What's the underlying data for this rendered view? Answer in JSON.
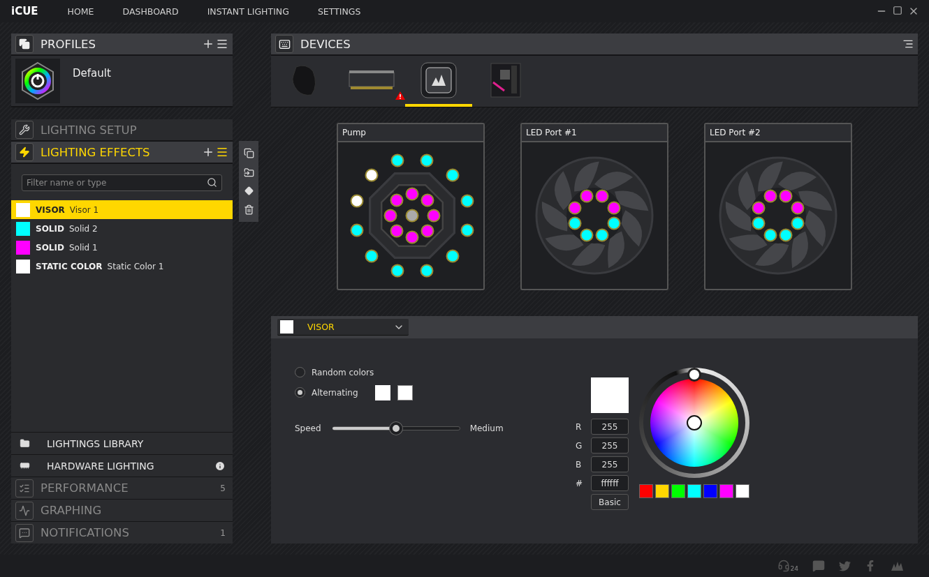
{
  "app": {
    "logo": "iCUE",
    "nav": [
      {
        "label": "HOME"
      },
      {
        "label": "DASHBOARD"
      },
      {
        "label": "INSTANT LIGHTING"
      },
      {
        "label": "SETTINGS"
      }
    ]
  },
  "profiles": {
    "title": "PROFILES",
    "items": [
      {
        "name": "Default"
      }
    ]
  },
  "sections": [
    {
      "label": "LIGHTING SETUP",
      "selected": false
    },
    {
      "label": "LIGHTING EFFECTS",
      "selected": true
    }
  ],
  "filter": {
    "placeholder": "Filter name or type"
  },
  "effects": [
    {
      "type": "VISOR",
      "name": "Visor 1",
      "color": "#ffffff",
      "selected": true
    },
    {
      "type": "SOLID",
      "name": "Solid 2",
      "color": "#00ffff",
      "selected": false
    },
    {
      "type": "SOLID",
      "name": "Solid 1",
      "color": "#ff00ff",
      "selected": false
    },
    {
      "type": "STATIC COLOR",
      "name": "Static Color 1",
      "color": "#ffffff",
      "selected": false
    }
  ],
  "bottom_items": [
    {
      "kind": "library",
      "label": "LIGHTINGS LIBRARY"
    },
    {
      "kind": "hardware",
      "label": "HARDWARE LIGHTING",
      "info": true
    },
    {
      "kind": "performance",
      "label": "PERFORMANCE",
      "badge": "5"
    },
    {
      "kind": "graphing",
      "label": "GRAPHING"
    },
    {
      "kind": "notifications",
      "label": "NOTIFICATIONS",
      "badge": "1"
    }
  ],
  "devices": {
    "title": "DEVICES",
    "items": [
      {
        "kind": "mouse",
        "selected": false,
        "warning": false
      },
      {
        "kind": "memory",
        "selected": false,
        "warning": true
      },
      {
        "kind": "cooler",
        "selected": true,
        "warning": false
      },
      {
        "kind": "motherboard",
        "selected": false,
        "warning": false
      }
    ]
  },
  "zones": [
    {
      "label": "Pump",
      "kind": "pump",
      "outer": [
        {
          "color": "#00ffff"
        },
        {
          "color": "#00ffff"
        },
        {
          "color": "#00ffff"
        },
        {
          "color": "#00ffff"
        },
        {
          "color": "#00ffff"
        },
        {
          "color": "#00ffff"
        },
        {
          "color": "#00ffff"
        },
        {
          "color": "#00ffff"
        },
        {
          "color": "#00ffff"
        },
        {
          "color": "#ffffff"
        },
        {
          "color": "#ffffff"
        },
        {
          "color": "#00ffff"
        }
      ],
      "inner": [
        {
          "color": "#ff00ff"
        },
        {
          "color": "#ff00ff"
        },
        {
          "color": "#ff00ff"
        },
        {
          "color": "#ff00ff"
        },
        {
          "color": "#ff00ff"
        },
        {
          "color": "#ff00ff"
        },
        {
          "color": "#ff00ff"
        },
        {
          "color": "#ff00ff"
        }
      ],
      "center": {
        "color": "#aaaaaa"
      }
    },
    {
      "label": "LED Port #1",
      "kind": "fan",
      "inner": [
        {
          "color": "#ff00ff"
        },
        {
          "color": "#ff00ff"
        },
        {
          "color": "#00ffff"
        },
        {
          "color": "#00ffff"
        },
        {
          "color": "#00ffff"
        },
        {
          "color": "#00ffff"
        },
        {
          "color": "#ff00ff"
        },
        {
          "color": "#ff00ff"
        }
      ]
    },
    {
      "label": "LED Port #2",
      "kind": "fan",
      "inner": [
        {
          "color": "#ff00ff"
        },
        {
          "color": "#ff00ff"
        },
        {
          "color": "#00ffff"
        },
        {
          "color": "#00ffff"
        },
        {
          "color": "#00ffff"
        },
        {
          "color": "#00ffff"
        },
        {
          "color": "#ff00ff"
        },
        {
          "color": "#ff00ff"
        }
      ]
    }
  ],
  "effect_editor": {
    "effect": {
      "label": "VISOR",
      "color": "#ffffff"
    },
    "options": [
      {
        "label": "Random colors",
        "selected": false
      },
      {
        "label": "Alternating",
        "selected": true,
        "colors": [
          {
            "color": "#ffffff"
          },
          {
            "color": "#ffffff"
          }
        ]
      }
    ],
    "speed": {
      "label": "Speed",
      "level": 0.5,
      "reading": "Medium"
    },
    "picker": {
      "color": "#ffffff",
      "fields": [
        {
          "label": "R",
          "value": "255"
        },
        {
          "label": "G",
          "value": "255"
        },
        {
          "label": "B",
          "value": "255"
        },
        {
          "label": "#",
          "value": "ffffff"
        }
      ],
      "mode_button": "Basic",
      "swatches": [
        {
          "color": "#ff0000"
        },
        {
          "color": "#ffd700"
        },
        {
          "color": "#00ff00"
        },
        {
          "color": "#00ffff"
        },
        {
          "color": "#0000ff"
        },
        {
          "color": "#ff00ff"
        },
        {
          "color": "#ffffff"
        }
      ]
    }
  },
  "footer": {
    "support_badge": "24"
  }
}
